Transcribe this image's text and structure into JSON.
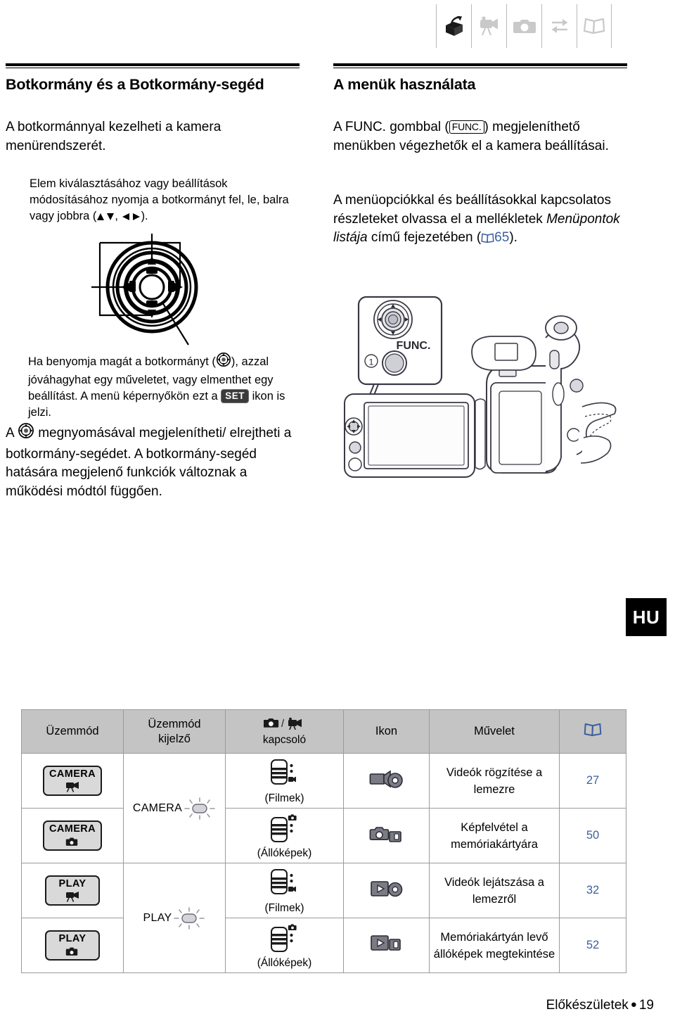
{
  "tabs": [
    {
      "name": "preparations-icon",
      "label": "Előkészületek",
      "active": true
    },
    {
      "name": "video-icon",
      "label": "Videó",
      "active": false
    },
    {
      "name": "photos-icon",
      "label": "Fényképek",
      "active": false
    },
    {
      "name": "external-connections-icon",
      "label": "Külső csatlakozások",
      "active": false
    },
    {
      "name": "additional-information-icon",
      "label": "További információ",
      "active": false
    }
  ],
  "left_column": {
    "heading": "Botkormány és a Botkormány-segéd",
    "intro": "A botkormánnyal kezelheti a kamera menürendszerét.",
    "joystick_note_pre": "Elem kiválasztásához vagy beállítások módosításához nyomja a botkormányt fel, le, balra vagy jobbra (",
    "joystick_note_post": ").",
    "press_note_pre": "Ha benyomja magát a botkormányt (",
    "press_note_mid": "), azzal jóváhagyhat egy műveletet, vagy elmenthet egy beállítást. A menü képernyőkön ezt a",
    "set_icon_label": "SET",
    "press_note_post": "ikon is jelzi.",
    "guide_note_pre": "A",
    "guide_note_post": "megnyomásával megjelenítheti/ elrejtheti a botkormány-segédet. A botkormány-segéd hatására megjelenő funkciók változnak a működési módtól függően."
  },
  "right_column": {
    "heading": "A menük használata",
    "para1_pre": "A FUNC. gombbal (",
    "func_key_label": "FUNC.",
    "para1_post": ")",
    "para2": "megjeleníthető menükben végezhetők el a kamera beállításai.",
    "para3_a": "A menüopciókkal és beállításokkal kapcsolatos részleteket olvassa el a mellékletek",
    "para3_italic": "Menüpontok listája",
    "para3_b": "című fejezetében (",
    "page_ref": "65",
    "para3_c": ").",
    "callout_number": "1",
    "func_button_label": "FUNC."
  },
  "locale_badge": "HU",
  "table": {
    "headers": {
      "mode": "Üzemmód",
      "mode_indicator_l1": "Üzemmód",
      "mode_indicator_l2": "kijelző",
      "switch_l2": "kapcsoló",
      "icon": "Ikon",
      "operation": "Művelet",
      "page": "book-icon"
    },
    "dial_camera": "CAMERA",
    "dial_play": "PLAY",
    "rows": [
      {
        "mode_chip": "CAMERA",
        "mode_chip_glyph": "movie",
        "dial": "CAMERA",
        "switch_glyph": "movie",
        "switch_label": "(Filmek)",
        "icon": "record-video-disc-icon",
        "operation": "Videók rögzítése a lemezre",
        "page": "27"
      },
      {
        "mode_chip": "CAMERA",
        "mode_chip_glyph": "photo",
        "dial": "CAMERA",
        "switch_glyph": "photo",
        "switch_label": "(Állóképek)",
        "icon": "record-photo-card-icon",
        "operation": "Képfelvétel a memóriakártyára",
        "page": "50"
      },
      {
        "mode_chip": "PLAY",
        "mode_chip_glyph": "movie",
        "dial": "PLAY",
        "switch_glyph": "movie",
        "switch_label": "(Filmek)",
        "icon": "play-video-disc-icon",
        "operation": "Videók lejátszása a lemezről",
        "page": "32"
      },
      {
        "mode_chip": "PLAY",
        "mode_chip_glyph": "photo",
        "dial": "PLAY",
        "switch_glyph": "photo",
        "switch_label": "(Állóképek)",
        "icon": "play-photo-card-icon",
        "operation": "Memóriakártyán levő állóképek megtekintése",
        "page": "52"
      }
    ]
  },
  "footer": {
    "section": "Előkészületek",
    "page_number": "19"
  },
  "colors": {
    "reference_blue": "#3d5f9e",
    "header_grey": "#c4c4c4",
    "border_grey": "#9a9a9a",
    "inactive_icon": "#c9c9c9"
  }
}
